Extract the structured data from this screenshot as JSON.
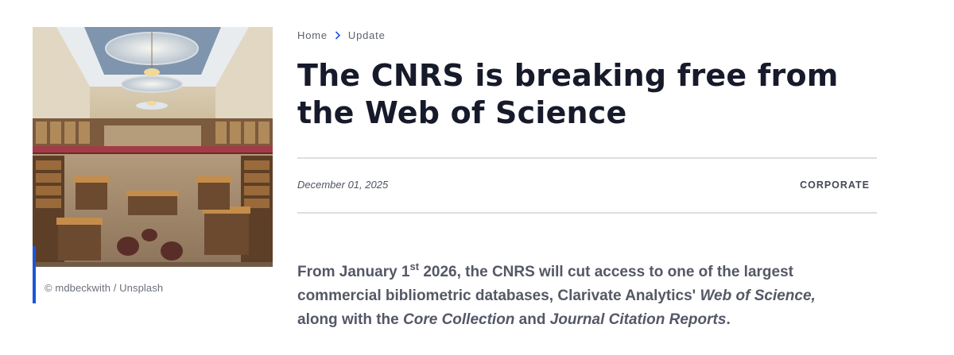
{
  "media": {
    "image_alt": "Library interior with glass dome ceiling and bookshelves",
    "credit": "© mdbeckwith / Unsplash"
  },
  "breadcrumb": {
    "home": "Home",
    "separator_icon": "chevron-right-icon",
    "current": "Update"
  },
  "article": {
    "title": "The CNRS is breaking free from the Web of Science",
    "date": "December 01, 2025",
    "category": "CORPORATE",
    "lead": {
      "p1": "From January 1",
      "sup": "st",
      "p2": " 2026, the CNRS will cut access to one of the largest commercial bibliometric databases, Clarivate Analytics' ",
      "em1": "Web of Science,",
      "p3": " along with the ",
      "em2": "Core Collection",
      "p4": " and ",
      "em3": "Journal Citation Reports",
      "p5": "."
    }
  },
  "colors": {
    "accent": "#1c56d8",
    "title": "#161a2a",
    "rule": "#dcdee3"
  }
}
